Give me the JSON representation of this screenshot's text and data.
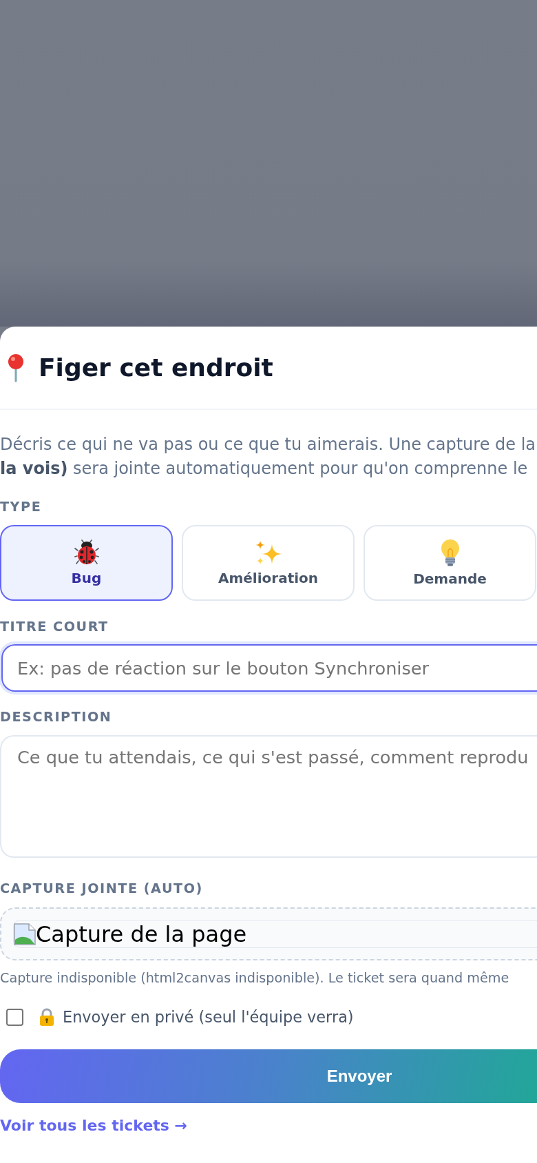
{
  "sheet": {
    "title": "Figer cet endroit"
  },
  "intro": {
    "lines": [
      "Décris ce qui ne va pas ou ce que tu aimerais. Une capture de la",
      "**la vois)** sera jointe automatiquement pour qu'on comprenne le"
    ]
  },
  "type_field": {
    "label": "TYPE",
    "options": [
      {
        "kind": "bug",
        "label": "Bug",
        "selected": true
      },
      {
        "kind": "improvement",
        "label": "Amélioration",
        "selected": false
      },
      {
        "kind": "request",
        "label": "Demande",
        "selected": false
      }
    ]
  },
  "title_field": {
    "label": "TITRE COURT",
    "placeholder": "Ex: pas de réaction sur le bouton Synchroniser",
    "focused": true
  },
  "description_field": {
    "label": "DESCRIPTION",
    "placeholder": "Ce que tu attendais, ce qui s'est passé, comment reprodu"
  },
  "capture": {
    "label": "CAPTURE JOINTE (AUTO)",
    "alt_text": "Capture de la page",
    "note": "Capture indisponible (html2canvas indisponible). Le ticket sera quand même"
  },
  "private_option": {
    "label": "Envoyer en privé (seul l'équipe verra)",
    "checked": false
  },
  "submit_button": {
    "label": "Envoyer"
  },
  "tickets_link": {
    "label": "Voir tous les tickets →"
  }
}
